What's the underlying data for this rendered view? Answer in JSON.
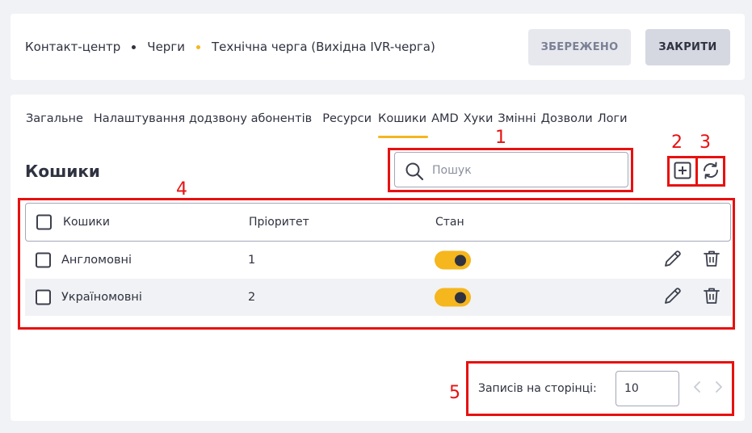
{
  "breadcrumb": {
    "items": [
      "Контакт-центр",
      "Черги",
      "Технічна черга (Вихідна IVR-черга)"
    ],
    "dot_colors": [
      "#2f3240",
      "#f5b61e"
    ]
  },
  "header_buttons": {
    "saved_label": "ЗБЕРЕЖЕНО",
    "close_label": "ЗАКРИТИ"
  },
  "tabs": [
    {
      "label": "Загальне",
      "active": false
    },
    {
      "label": "Налаштування додзвону абонентів",
      "active": false
    },
    {
      "label": "Ресурси",
      "active": false
    },
    {
      "label": "Кошики",
      "active": true
    },
    {
      "label": "AMD",
      "active": false
    },
    {
      "label": "Хуки",
      "active": false
    },
    {
      "label": "Змінні",
      "active": false
    },
    {
      "label": "Дозволи",
      "active": false
    },
    {
      "label": "Логи",
      "active": false
    }
  ],
  "page_title": "Кошики",
  "search": {
    "placeholder": "Пошук",
    "value": "",
    "icon": "search-icon"
  },
  "toolbar_icons": {
    "add": "add-square-icon",
    "refresh": "refresh-icon"
  },
  "table": {
    "columns": [
      "Кошики",
      "Пріоритет",
      "Стан"
    ],
    "rows": [
      {
        "name": "Англомовні",
        "priority": "1",
        "enabled": true
      },
      {
        "name": "Україномовні",
        "priority": "2",
        "enabled": true
      }
    ],
    "row_actions": [
      "pencil-icon",
      "trash-icon"
    ]
  },
  "pagination": {
    "label": "Записів на сторінці:",
    "page_size": "10"
  },
  "annotations": [
    "1",
    "2",
    "3",
    "4",
    "5"
  ],
  "colors": {
    "accent": "#f5b61e",
    "annotation": "#e81010",
    "text": "#2f3240"
  }
}
